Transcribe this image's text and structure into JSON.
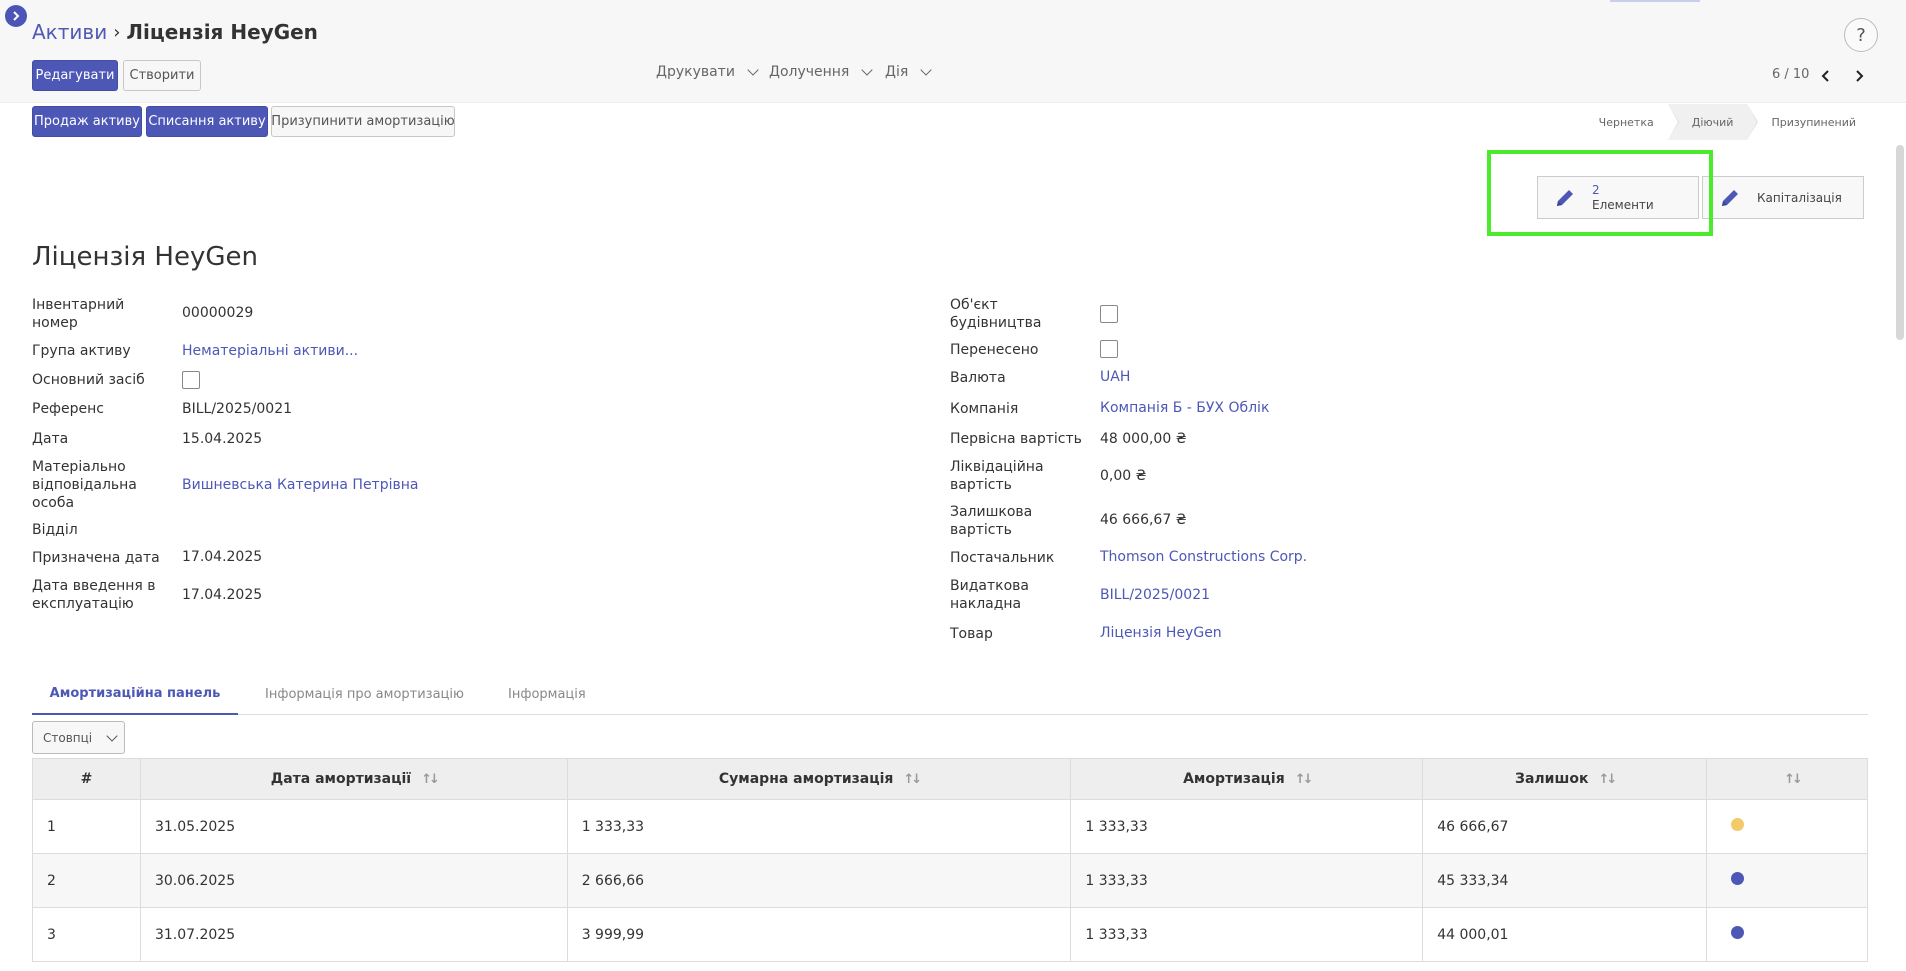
{
  "breadcrumb": {
    "parent": "Активи",
    "current": "Ліцензія HeyGen"
  },
  "help_label": "?",
  "toolbar": {
    "edit": "Редагувати",
    "create": "Створити",
    "print": "Друкувати",
    "attachments": "Долучення",
    "action": "Дія",
    "pager": "6 / 10"
  },
  "actions": {
    "sell": "Продаж активу",
    "dispose": "Списання активу",
    "pause": "Призупинити амортизацію"
  },
  "status": {
    "steps": [
      "Чернетка",
      "Діючий",
      "Призупинений"
    ],
    "current": "Діючий"
  },
  "smart_buttons": {
    "elements_count": "2",
    "elements_label": "Елементи",
    "capitalization": "Капіталізація"
  },
  "form": {
    "title": "Ліцензія HeyGen",
    "left": [
      {
        "label": "Інвентарний номер",
        "value": "00000029",
        "type": "text"
      },
      {
        "label": "Група активу",
        "value": "Нематеріальні активи...",
        "type": "link"
      },
      {
        "label": "Основний засіб",
        "value": "",
        "type": "checkbox"
      },
      {
        "label": "Референс",
        "value": "BILL/2025/0021",
        "type": "text"
      },
      {
        "label": "Дата",
        "value": "15.04.2025",
        "type": "text"
      },
      {
        "label": "Матеріально відповідальна особа",
        "value": "Вишневська Катерина Петрівна",
        "type": "link"
      },
      {
        "label": "Відділ",
        "value": "",
        "type": "text"
      },
      {
        "label": "Призначена дата",
        "value": "17.04.2025",
        "type": "text"
      },
      {
        "label": "Дата введення в експлуатацію",
        "value": "17.04.2025",
        "type": "text"
      }
    ],
    "right": [
      {
        "label": "Об'єкт будівництва",
        "value": "",
        "type": "checkbox"
      },
      {
        "label": "Перенесено",
        "value": "",
        "type": "checkbox"
      },
      {
        "label": "Валюта",
        "value": "UAH",
        "type": "link"
      },
      {
        "label": "Компанія",
        "value": "Компанія Б - БУХ Облік",
        "type": "link"
      },
      {
        "label": "Первісна вартість",
        "value": "48 000,00 ₴",
        "type": "text"
      },
      {
        "label": "Ліквідаційна вартість",
        "value": "0,00 ₴",
        "type": "text"
      },
      {
        "label": "Залишкова вартість",
        "value": "46 666,67 ₴",
        "type": "text"
      },
      {
        "label": "Постачальник",
        "value": "Thomson Constructions Corp.",
        "type": "link"
      },
      {
        "label": "Видаткова накладна",
        "value": "BILL/2025/0021",
        "type": "link"
      },
      {
        "label": "Товар",
        "value": "Ліцензія HeyGen",
        "type": "link"
      }
    ]
  },
  "tabs": [
    "Амортизаційна панель",
    "Інформація про амортизацію",
    "Інформація"
  ],
  "columns_button": "Стовпці",
  "table": {
    "headers": [
      "#",
      "Дата амортизації",
      "Сумарна амортизація",
      "Амортизація",
      "Залишок",
      ""
    ],
    "rows": [
      {
        "n": "1",
        "date": "31.05.2025",
        "cumulative": "1 333,33",
        "amount": "1 333,33",
        "remaining": "46 666,67",
        "status_color": "#f3c96a"
      },
      {
        "n": "2",
        "date": "30.06.2025",
        "cumulative": "2 666,66",
        "amount": "1 333,33",
        "remaining": "45 333,34",
        "status_color": "#4d57b6"
      },
      {
        "n": "3",
        "date": "31.07.2025",
        "cumulative": "3 999,99",
        "amount": "1 333,33",
        "remaining": "44 000,01",
        "status_color": "#4d57b6"
      }
    ]
  },
  "colors": {
    "primary": "#4d57b6",
    "highlight": "#4cea2d"
  }
}
